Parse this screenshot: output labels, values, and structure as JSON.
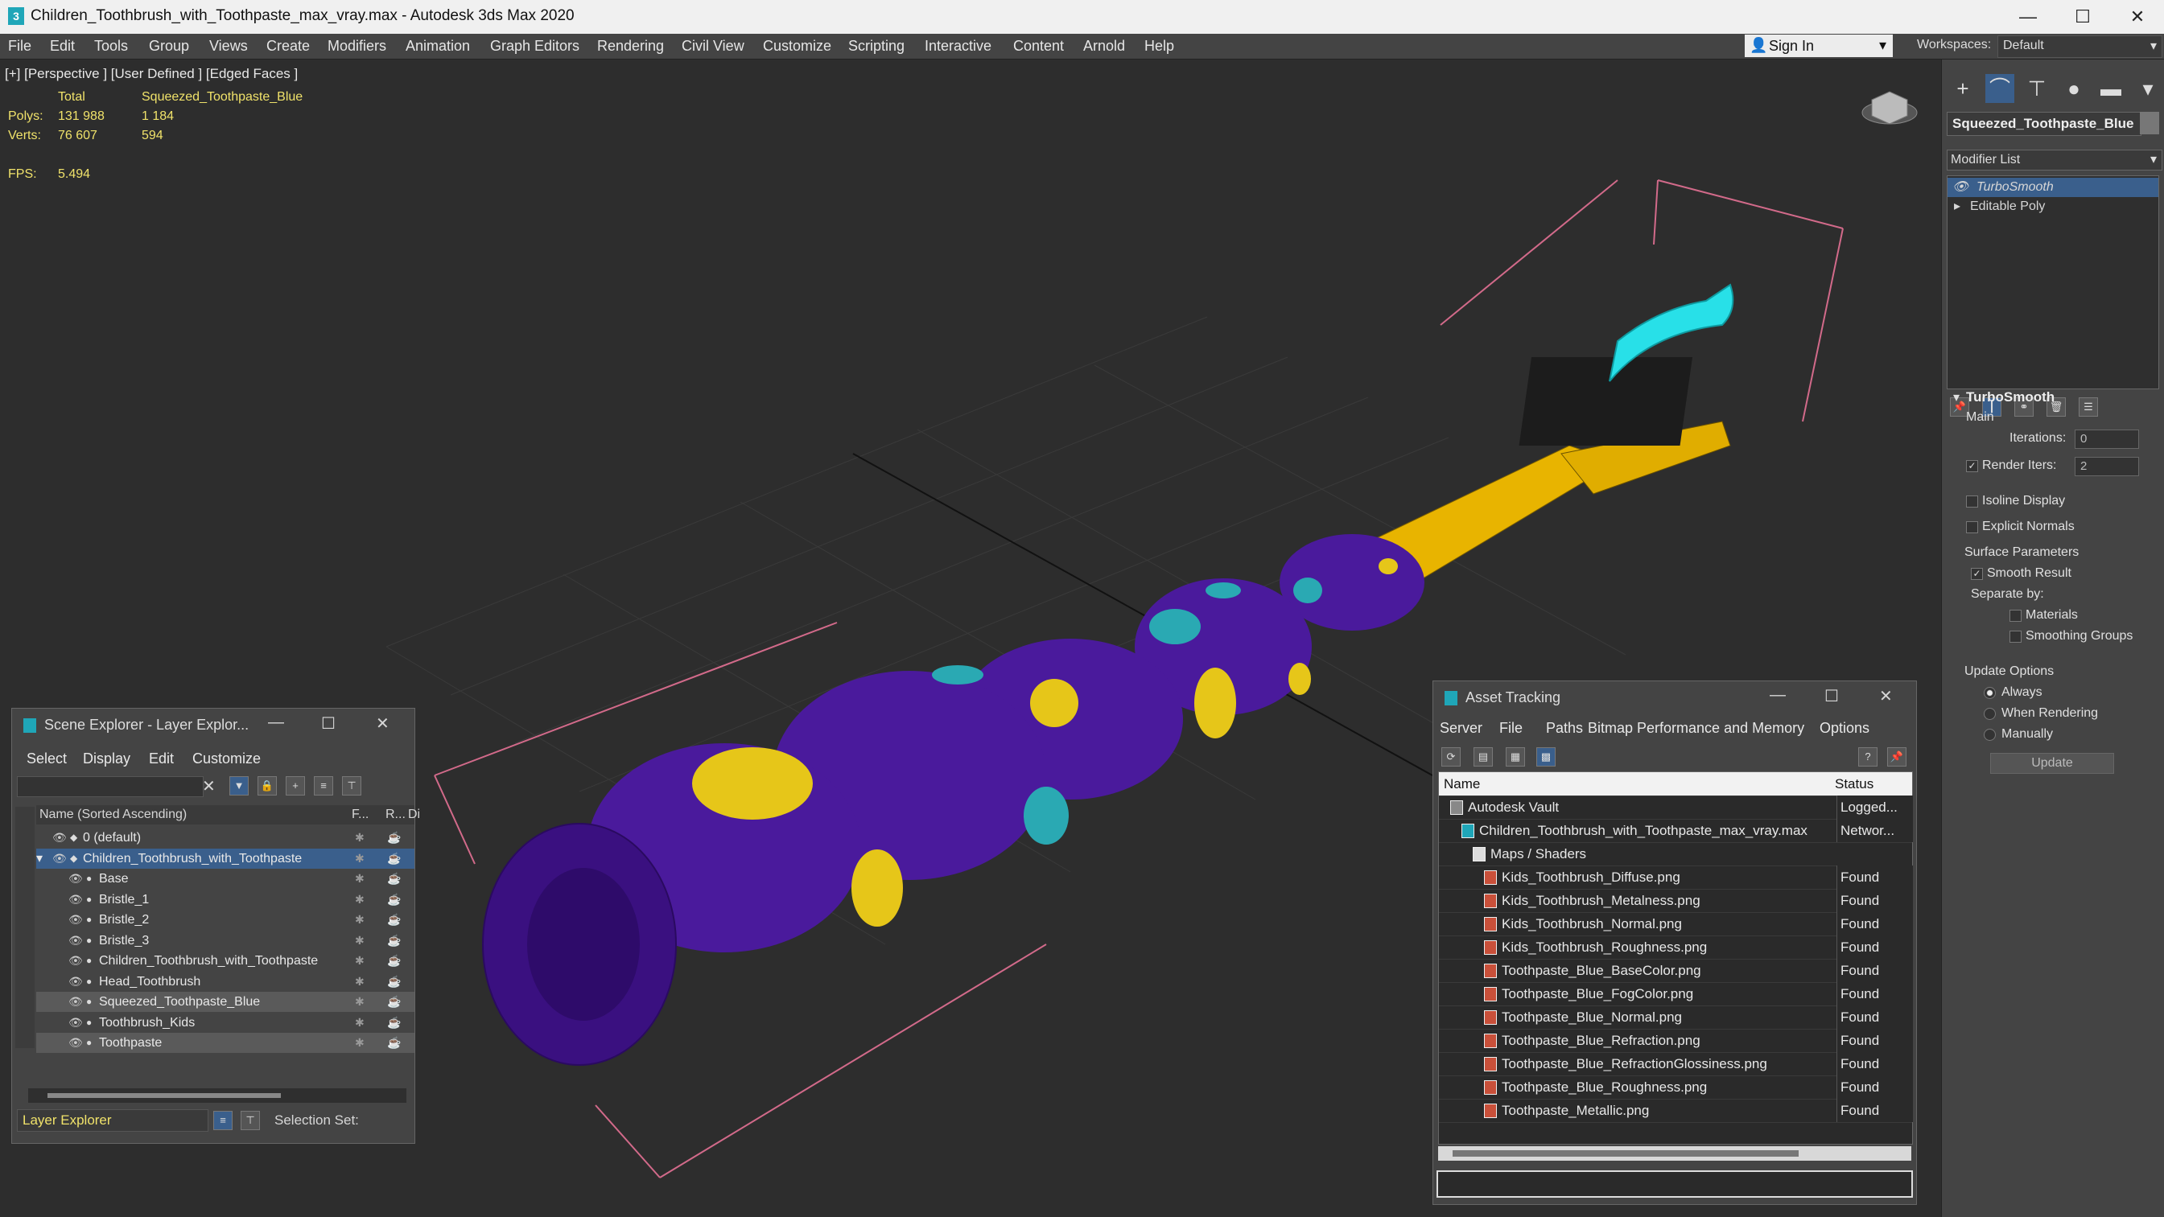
{
  "window": {
    "title": "Children_Toothbrush_with_Toothpaste_max_vray.max - Autodesk 3ds Max 2020",
    "minimize": "—",
    "maximize": "☐",
    "close": "✕"
  },
  "menu": [
    "File",
    "Edit",
    "Tools",
    "Group",
    "Views",
    "Create",
    "Modifiers",
    "Animation",
    "Graph Editors",
    "Rendering",
    "Civil View",
    "Customize",
    "Scripting",
    "Interactive",
    "Content",
    "Arnold",
    "Help"
  ],
  "signin": "Sign In",
  "workspaces": {
    "label": "Workspaces:",
    "value": "Default"
  },
  "viewport": {
    "label": "[+] [Perspective ] [User Defined ] [Edged Faces ]",
    "stats": {
      "total_label": "Total",
      "object_label": "Squeezed_Toothpaste_Blue",
      "polys_label": "Polys:",
      "polys_total": "131 988",
      "polys_obj": "1 184",
      "verts_label": "Verts:",
      "verts_total": "76 607",
      "verts_obj": "594",
      "fps_label": "FPS:",
      "fps": "5.494"
    }
  },
  "command_panel": {
    "object_name": "Squeezed_Toothpaste_Blue",
    "modifier_list": "Modifier List",
    "stack": [
      "TurboSmooth",
      "Editable Poly"
    ],
    "rollout": "TurboSmooth",
    "main": "Main",
    "iterations_label": "Iterations:",
    "iterations": "0",
    "render_iters_label": "Render Iters:",
    "render_iters": "2",
    "isoline": "Isoline Display",
    "explicit_normals": "Explicit Normals",
    "surface_params": "Surface Parameters",
    "smooth_result": "Smooth Result",
    "separate_by": "Separate by:",
    "materials": "Materials",
    "smoothing_groups": "Smoothing Groups",
    "update_options": "Update Options",
    "always": "Always",
    "when_rendering": "When Rendering",
    "manually": "Manually",
    "update_btn": "Update"
  },
  "scene_explorer": {
    "title": "Scene Explorer - Layer Explor...",
    "menu": [
      "Select",
      "Display",
      "Edit",
      "Customize"
    ],
    "col_name": "Name (Sorted Ascending)",
    "col_f": "F...",
    "col_r": "R...",
    "col_d": "Di",
    "rows": [
      {
        "name": "0 (default)",
        "indent": 1
      },
      {
        "name": "Children_Toothbrush_with_Toothpaste",
        "indent": 1
      },
      {
        "name": "Base",
        "indent": 2
      },
      {
        "name": "Bristle_1",
        "indent": 2
      },
      {
        "name": "Bristle_2",
        "indent": 2
      },
      {
        "name": "Bristle_3",
        "indent": 2
      },
      {
        "name": "Children_Toothbrush_with_Toothpaste",
        "indent": 2
      },
      {
        "name": "Head_Toothbrush",
        "indent": 2
      },
      {
        "name": "Squeezed_Toothpaste_Blue",
        "indent": 2
      },
      {
        "name": "Toothbrush_Kids",
        "indent": 2
      },
      {
        "name": "Toothpaste",
        "indent": 2
      }
    ],
    "footer_mode": "Layer Explorer",
    "selection_set": "Selection Set:"
  },
  "asset_tracking": {
    "title": "Asset Tracking",
    "menu": [
      "Server",
      "File",
      "Paths",
      "Bitmap Performance and Memory",
      "Options"
    ],
    "col_name": "Name",
    "col_status": "Status",
    "rows": [
      {
        "name": "Autodesk Vault",
        "status": "Logged...",
        "indent": 0
      },
      {
        "name": "Children_Toothbrush_with_Toothpaste_max_vray.max",
        "status": "Networ...",
        "indent": 1
      },
      {
        "name": "Maps / Shaders",
        "status": "",
        "indent": 2
      },
      {
        "name": "Kids_Toothbrush_Diffuse.png",
        "status": "Found",
        "indent": 3
      },
      {
        "name": "Kids_Toothbrush_Metalness.png",
        "status": "Found",
        "indent": 3
      },
      {
        "name": "Kids_Toothbrush_Normal.png",
        "status": "Found",
        "indent": 3
      },
      {
        "name": "Kids_Toothbrush_Roughness.png",
        "status": "Found",
        "indent": 3
      },
      {
        "name": "Toothpaste_Blue_BaseColor.png",
        "status": "Found",
        "indent": 3
      },
      {
        "name": "Toothpaste_Blue_FogColor.png",
        "status": "Found",
        "indent": 3
      },
      {
        "name": "Toothpaste_Blue_Normal.png",
        "status": "Found",
        "indent": 3
      },
      {
        "name": "Toothpaste_Blue_Refraction.png",
        "status": "Found",
        "indent": 3
      },
      {
        "name": "Toothpaste_Blue_RefractionGlossiness.png",
        "status": "Found",
        "indent": 3
      },
      {
        "name": "Toothpaste_Blue_Roughness.png",
        "status": "Found",
        "indent": 3
      },
      {
        "name": "Toothpaste_Metallic.png",
        "status": "Found",
        "indent": 3
      }
    ]
  },
  "colors": {
    "accent": "#3a5f8c",
    "brush_body": "#4a1a9c",
    "brush_neck": "#e8b400",
    "paste": "#28e0e8",
    "spot_yellow": "#e6c619",
    "spot_cyan": "#2aa9b3"
  }
}
